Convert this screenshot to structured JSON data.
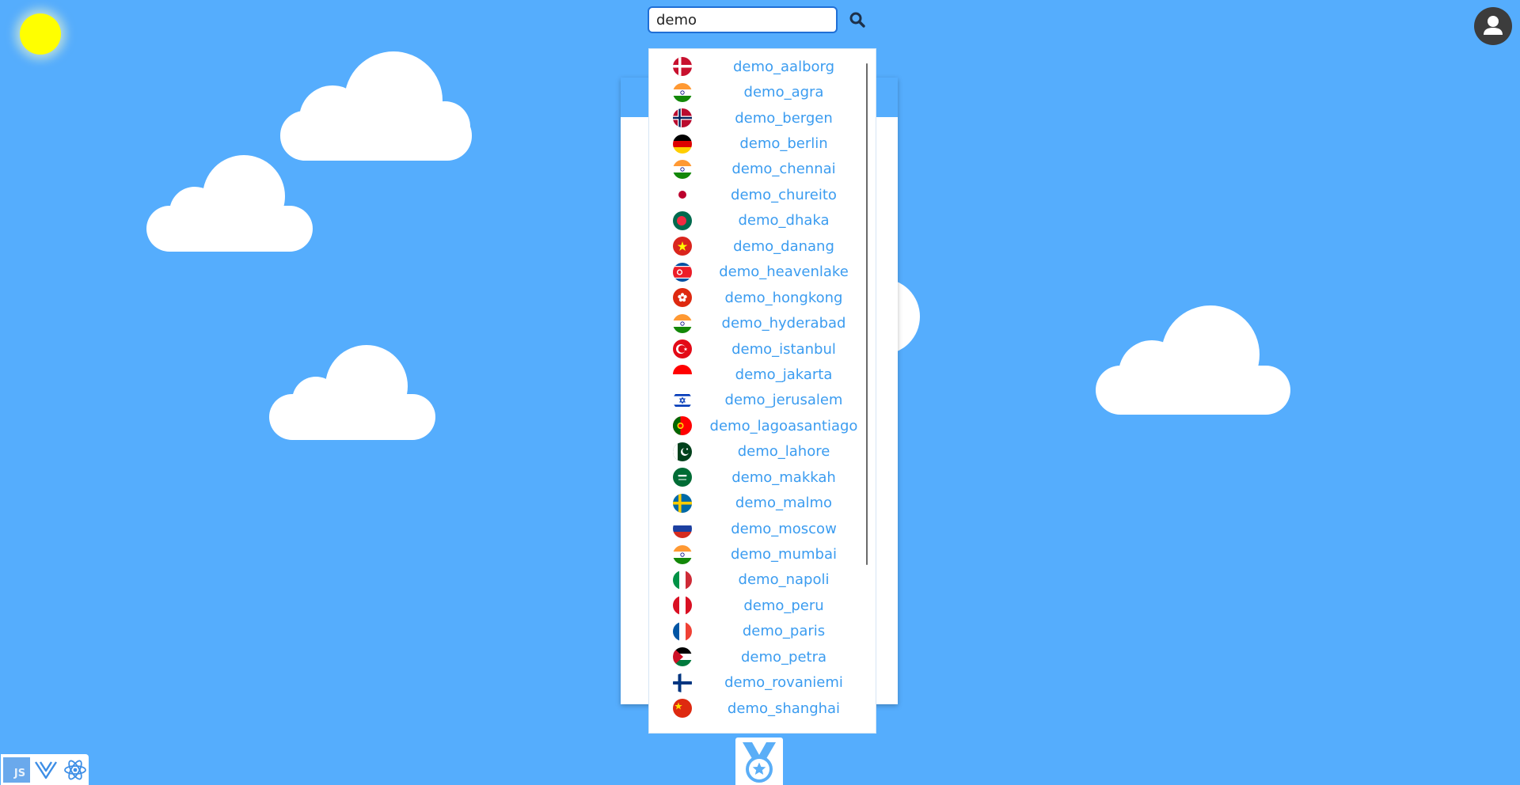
{
  "search": {
    "value": "demo",
    "placeholder": ""
  },
  "icons": {
    "sun": "sun-icon",
    "search": "search-icon",
    "user": "user-icon",
    "medal": "medal-icon",
    "js": "js-icon",
    "vue": "vue-icon",
    "react": "react-icon"
  },
  "dropdown": {
    "items": [
      {
        "label": "demo_aalborg",
        "flag": "denmark"
      },
      {
        "label": "demo_agra",
        "flag": "india"
      },
      {
        "label": "demo_bergen",
        "flag": "norway"
      },
      {
        "label": "demo_berlin",
        "flag": "germany"
      },
      {
        "label": "demo_chennai",
        "flag": "india"
      },
      {
        "label": "demo_chureito",
        "flag": "japan"
      },
      {
        "label": "demo_dhaka",
        "flag": "bangladesh"
      },
      {
        "label": "demo_danang",
        "flag": "vietnam"
      },
      {
        "label": "demo_heavenlake",
        "flag": "north-korea"
      },
      {
        "label": "demo_hongkong",
        "flag": "hong-kong"
      },
      {
        "label": "demo_hyderabad",
        "flag": "india"
      },
      {
        "label": "demo_istanbul",
        "flag": "turkey"
      },
      {
        "label": "demo_jakarta",
        "flag": "indonesia"
      },
      {
        "label": "demo_jerusalem",
        "flag": "israel"
      },
      {
        "label": "demo_lagoasantiago",
        "flag": "portugal"
      },
      {
        "label": "demo_lahore",
        "flag": "pakistan"
      },
      {
        "label": "demo_makkah",
        "flag": "saudi-arabia"
      },
      {
        "label": "demo_malmo",
        "flag": "sweden"
      },
      {
        "label": "demo_moscow",
        "flag": "russia"
      },
      {
        "label": "demo_mumbai",
        "flag": "india"
      },
      {
        "label": "demo_napoli",
        "flag": "italy"
      },
      {
        "label": "demo_peru",
        "flag": "peru"
      },
      {
        "label": "demo_paris",
        "flag": "france"
      },
      {
        "label": "demo_petra",
        "flag": "jordan"
      },
      {
        "label": "demo_rovaniemi",
        "flag": "finland"
      },
      {
        "label": "demo_shanghai",
        "flag": "china"
      }
    ]
  },
  "framework_switcher": {
    "options": [
      {
        "label": "JS",
        "icon": "js-icon",
        "active": true
      },
      {
        "label": "",
        "icon": "vue-icon",
        "active": false
      },
      {
        "label": "",
        "icon": "react-icon",
        "active": false
      }
    ]
  },
  "colors": {
    "sky": "#55adfd",
    "sun": "#ffff00",
    "link": "#3b9cf0",
    "search_border": "#1f6fd6"
  }
}
